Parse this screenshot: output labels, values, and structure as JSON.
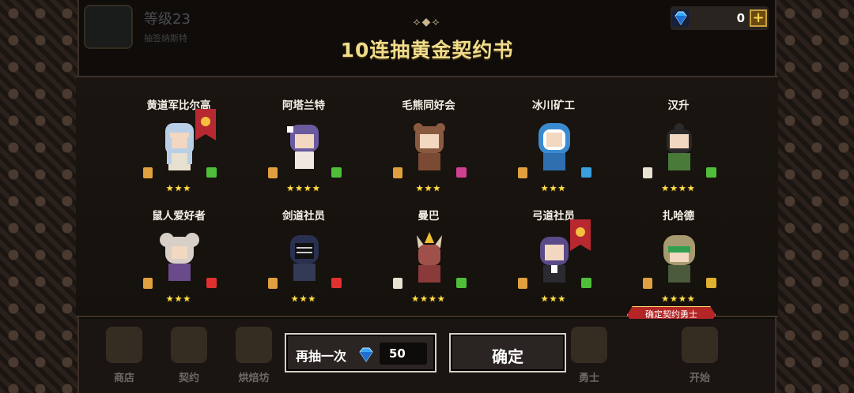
{
  "header": {
    "level": "等级23",
    "level_sub": "抽签纳斯特",
    "title": "10连抽黄金契约书",
    "gems": "0",
    "plus": "+"
  },
  "heroes": [
    {
      "name": "黄道军比尔高",
      "stars": "★★★",
      "element_color": "#4fbf3a",
      "scroll": "gold",
      "banner": true
    },
    {
      "name": "阿塔兰特",
      "stars": "★★★★",
      "element_color": "#4fbf3a",
      "scroll": "gold",
      "banner": false
    },
    {
      "name": "毛熊同好会",
      "stars": "★★★",
      "element_color": "#d04090",
      "scroll": "gold",
      "banner": false
    },
    {
      "name": "冰川矿工",
      "stars": "★★★",
      "element_color": "#3aa0e0",
      "scroll": "gold",
      "banner": false
    },
    {
      "name": "汉升",
      "stars": "★★★★",
      "element_color": "#4fbf3a",
      "scroll": "white",
      "banner": false
    },
    {
      "name": "鼠人爱好者",
      "stars": "★★★",
      "element_color": "#e03030",
      "scroll": "gold",
      "banner": false
    },
    {
      "name": "剑道社员",
      "stars": "★★★",
      "element_color": "#e03030",
      "scroll": "gold",
      "banner": false
    },
    {
      "name": "曼巴",
      "stars": "★★★★",
      "element_color": "#4fbf3a",
      "scroll": "white",
      "banner": false
    },
    {
      "name": "弓道社员",
      "stars": "★★★",
      "element_color": "#4fbf3a",
      "scroll": "gold",
      "banner": true
    },
    {
      "name": "扎哈德",
      "stars": "★★★★",
      "element_color": "#e0b030",
      "scroll": "gold",
      "banner": false
    }
  ],
  "confirm_tag": "确定契约勇士",
  "buttons": {
    "redraw_label": "再抽一次",
    "redraw_cost": "50",
    "confirm_label": "确定"
  },
  "menu": [
    {
      "label": "商店",
      "icon": "shop-icon"
    },
    {
      "label": "契约",
      "icon": "contract-icon"
    },
    {
      "label": "烘焙坊",
      "icon": "bakery-icon"
    },
    {
      "label": "勇士",
      "icon": "hero-icon"
    },
    {
      "label": "开始",
      "icon": "start-icon"
    }
  ]
}
